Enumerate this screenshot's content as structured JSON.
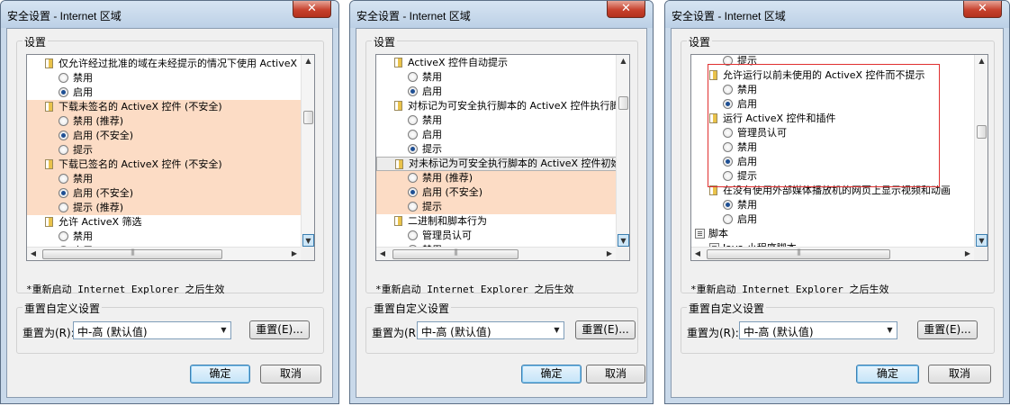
{
  "dialogs": [
    {
      "title": "安全设置 - Internet 区域",
      "close_label": "✕",
      "settings_label": "设置",
      "rows": [
        {
          "type": "header",
          "text": "仅允许经过批准的域在未经提示的情况下使用 ActiveX",
          "icon": "activex-control-icon"
        },
        {
          "type": "option",
          "text": "禁用",
          "checked": false
        },
        {
          "type": "option",
          "text": "启用",
          "checked": true
        },
        {
          "type": "header",
          "text": "下载未签名的 ActiveX 控件 (不安全)",
          "icon": "activex-control-icon",
          "highlight": true
        },
        {
          "type": "option",
          "text": "禁用 (推荐)",
          "checked": false,
          "highlight": true
        },
        {
          "type": "option",
          "text": "启用 (不安全)",
          "checked": true,
          "highlight": true
        },
        {
          "type": "option",
          "text": "提示",
          "checked": false,
          "highlight": true
        },
        {
          "type": "header",
          "text": "下载已签名的 ActiveX 控件 (不安全)",
          "icon": "activex-control-icon",
          "highlight": true
        },
        {
          "type": "option",
          "text": "禁用",
          "checked": false,
          "highlight": true
        },
        {
          "type": "option",
          "text": "启用 (不安全)",
          "checked": true,
          "highlight": true
        },
        {
          "type": "option",
          "text": "提示 (推荐)",
          "checked": false,
          "highlight": true
        },
        {
          "type": "header",
          "text": "允许 ActiveX 筛选",
          "icon": "activex-control-icon"
        },
        {
          "type": "option",
          "text": "禁用",
          "checked": false
        },
        {
          "type": "option",
          "text": "启用",
          "checked": true
        }
      ],
      "note": "*重新启动 Internet Explorer 之后生效",
      "reset_group_label": "重置自定义设置",
      "reset_to_label": "重置为(R):",
      "reset_level": "中-高 (默认值)",
      "reset_button": "重置(E)...",
      "ok_button": "确定",
      "cancel_button": "取消"
    },
    {
      "title": "安全设置 - Internet 区域",
      "close_label": "✕",
      "settings_label": "设置",
      "rows": [
        {
          "type": "header",
          "text": "ActiveX 控件自动提示",
          "icon": "activex-control-icon"
        },
        {
          "type": "option",
          "text": "禁用",
          "checked": false
        },
        {
          "type": "option",
          "text": "启用",
          "checked": true
        },
        {
          "type": "header",
          "text": "对标记为可安全执行脚本的 ActiveX 控件执行脚本*",
          "icon": "activex-control-icon"
        },
        {
          "type": "option",
          "text": "禁用",
          "checked": false
        },
        {
          "type": "option",
          "text": "启用",
          "checked": false
        },
        {
          "type": "option",
          "text": "提示",
          "checked": true
        },
        {
          "type": "header",
          "text": "对未标记为可安全执行脚本的 ActiveX 控件初始化并执行脚本",
          "icon": "activex-control-icon",
          "highlight": true,
          "tooltip": true
        },
        {
          "type": "option",
          "text": "禁用 (推荐)",
          "checked": false,
          "highlight": true
        },
        {
          "type": "option",
          "text": "启用 (不安全)",
          "checked": true,
          "highlight": true
        },
        {
          "type": "option",
          "text": "提示",
          "checked": false,
          "highlight": true
        },
        {
          "type": "header",
          "text": "二进制和脚本行为",
          "icon": "activex-control-icon"
        },
        {
          "type": "option",
          "text": "管理员认可",
          "checked": false
        },
        {
          "type": "option",
          "text": "禁用",
          "checked": true
        }
      ],
      "note": "*重新启动 Internet Explorer 之后生效",
      "reset_group_label": "重置自定义设置",
      "reset_to_label": "重置为(R):",
      "reset_level": "中-高 (默认值)",
      "reset_button": "重置(E)...",
      "ok_button": "确定",
      "cancel_button": "取消"
    },
    {
      "title": "安全设置 - Internet 区域",
      "close_label": "✕",
      "settings_label": "设置",
      "rows": [
        {
          "type": "option",
          "text": "提示",
          "checked": false
        },
        {
          "type": "header",
          "text": "允许运行以前未使用的 ActiveX 控件而不提示",
          "icon": "activex-control-icon"
        },
        {
          "type": "option",
          "text": "禁用",
          "checked": false
        },
        {
          "type": "option",
          "text": "启用",
          "checked": true
        },
        {
          "type": "header",
          "text": "运行 ActiveX 控件和插件",
          "icon": "activex-control-icon"
        },
        {
          "type": "option",
          "text": "管理员认可",
          "checked": false
        },
        {
          "type": "option",
          "text": "禁用",
          "checked": false
        },
        {
          "type": "option",
          "text": "启用",
          "checked": true
        },
        {
          "type": "option",
          "text": "提示",
          "checked": false
        },
        {
          "type": "header",
          "text": "在没有使用外部媒体播放机的网页上显示视频和动画",
          "icon": "activex-control-icon"
        },
        {
          "type": "option",
          "text": "禁用",
          "checked": true
        },
        {
          "type": "option",
          "text": "启用",
          "checked": false
        },
        {
          "type": "category",
          "text": "脚本",
          "icon": "script-icon"
        },
        {
          "type": "header",
          "text": "Java 小程序脚本",
          "icon": "script-icon"
        }
      ],
      "note": "*重新启动 Internet Explorer 之后生效",
      "reset_group_label": "重置自定义设置",
      "reset_to_label": "重置为(R):",
      "reset_level": "中-高 (默认值)",
      "reset_button": "重置(E)...",
      "ok_button": "确定",
      "cancel_button": "取消"
    }
  ],
  "colors": {
    "highlight": "#fcdcc5",
    "annotation_box": "#e03030",
    "window_frame": "#c9d9ea",
    "close_button": "#c7422e"
  }
}
